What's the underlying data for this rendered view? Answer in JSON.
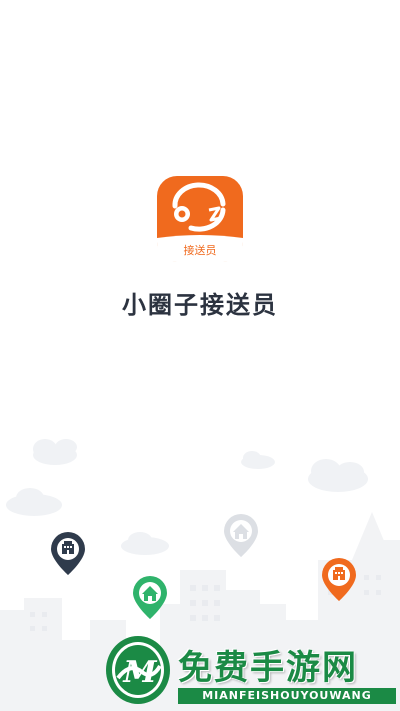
{
  "app": {
    "name": "小圈子接送员",
    "icon_badge": "接送员"
  },
  "colors": {
    "brand_orange": "#f06a1e",
    "pin_dark": "#2f3b4c",
    "pin_green": "#2fb36b",
    "pin_orange": "#f06a1e",
    "watermark_green": "#1b8a45"
  },
  "map_pins": [
    {
      "icon": "building-icon",
      "color": "dark"
    },
    {
      "icon": "home-icon",
      "color": "green"
    },
    {
      "icon": "home-icon",
      "color": "light-gray"
    },
    {
      "icon": "building-icon",
      "color": "orange"
    }
  ],
  "watermark": {
    "title": "免费手游网",
    "subtitle": "MIANFEISHOUYOUWANG"
  }
}
